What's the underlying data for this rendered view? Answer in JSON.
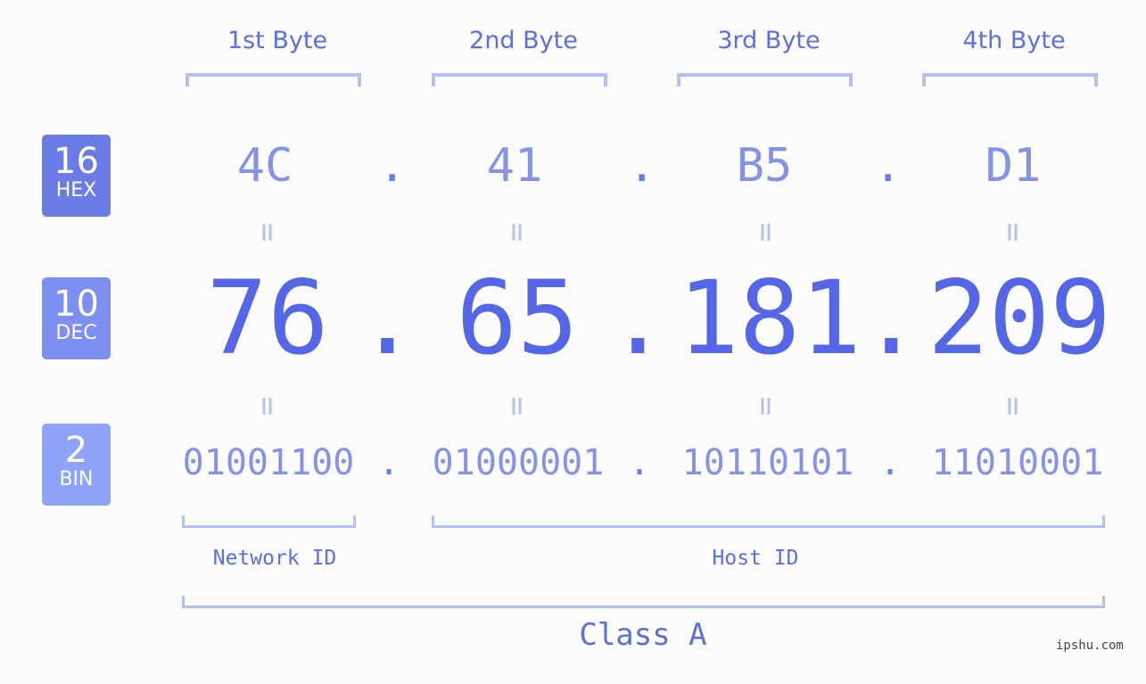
{
  "byte_headers": [
    "1st Byte",
    "2nd Byte",
    "3rd Byte",
    "4th Byte"
  ],
  "badges": {
    "hex": {
      "number": "16",
      "label": "HEX",
      "color": "#6c7ce7"
    },
    "dec": {
      "number": "10",
      "label": "DEC",
      "color": "#7d8ff0"
    },
    "bin": {
      "number": "2",
      "label": "BIN",
      "color": "#8fa3f8"
    }
  },
  "hex": [
    "4C",
    "41",
    "B5",
    "D1"
  ],
  "dec": [
    "76",
    "65",
    "181",
    "209"
  ],
  "bin": [
    "01001100",
    "01000001",
    "10110101",
    "11010001"
  ],
  "separator": ".",
  "equals": "=",
  "network_label": "Network ID",
  "host_label": "Host ID",
  "class_label": "Class A",
  "watermark": "ipshu.com",
  "colors": {
    "accent": "#5566e6",
    "light": "#b5c0f2"
  }
}
